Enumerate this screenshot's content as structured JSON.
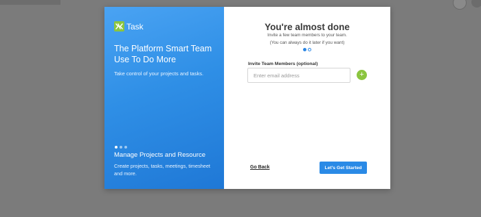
{
  "colors": {
    "backdrop": "#7b7b7b",
    "primary_blue": "#2a8ae6",
    "accent_green": "#8bc53f",
    "title_text": "#3a3a3a"
  },
  "brand": {
    "logo_icon": "task-logo-icon",
    "name": "Task"
  },
  "left_panel": {
    "headline": "The Platform Smart Team Use To Do More",
    "subline": "Take control of your projects and tasks.",
    "carousel": {
      "slide_count": 3,
      "active_index": 0
    },
    "feature_title": "Manage Projects and Resource",
    "feature_description": "Create projects, tasks, meetings, timesheet and more."
  },
  "right_panel": {
    "title": "You're almost done",
    "subtitle": "Invite a few team members to your team.",
    "note": "(You can always do it later if you want)",
    "step_indicator": {
      "step_count": 2,
      "active_index": 1
    },
    "invite": {
      "label": "Invite Team Members (optional)",
      "placeholder": "Enter email address",
      "value": "",
      "add_icon": "plus-icon",
      "add_label": "+"
    },
    "go_back_label": "Go Back",
    "submit_label": "Let's Get Started"
  }
}
